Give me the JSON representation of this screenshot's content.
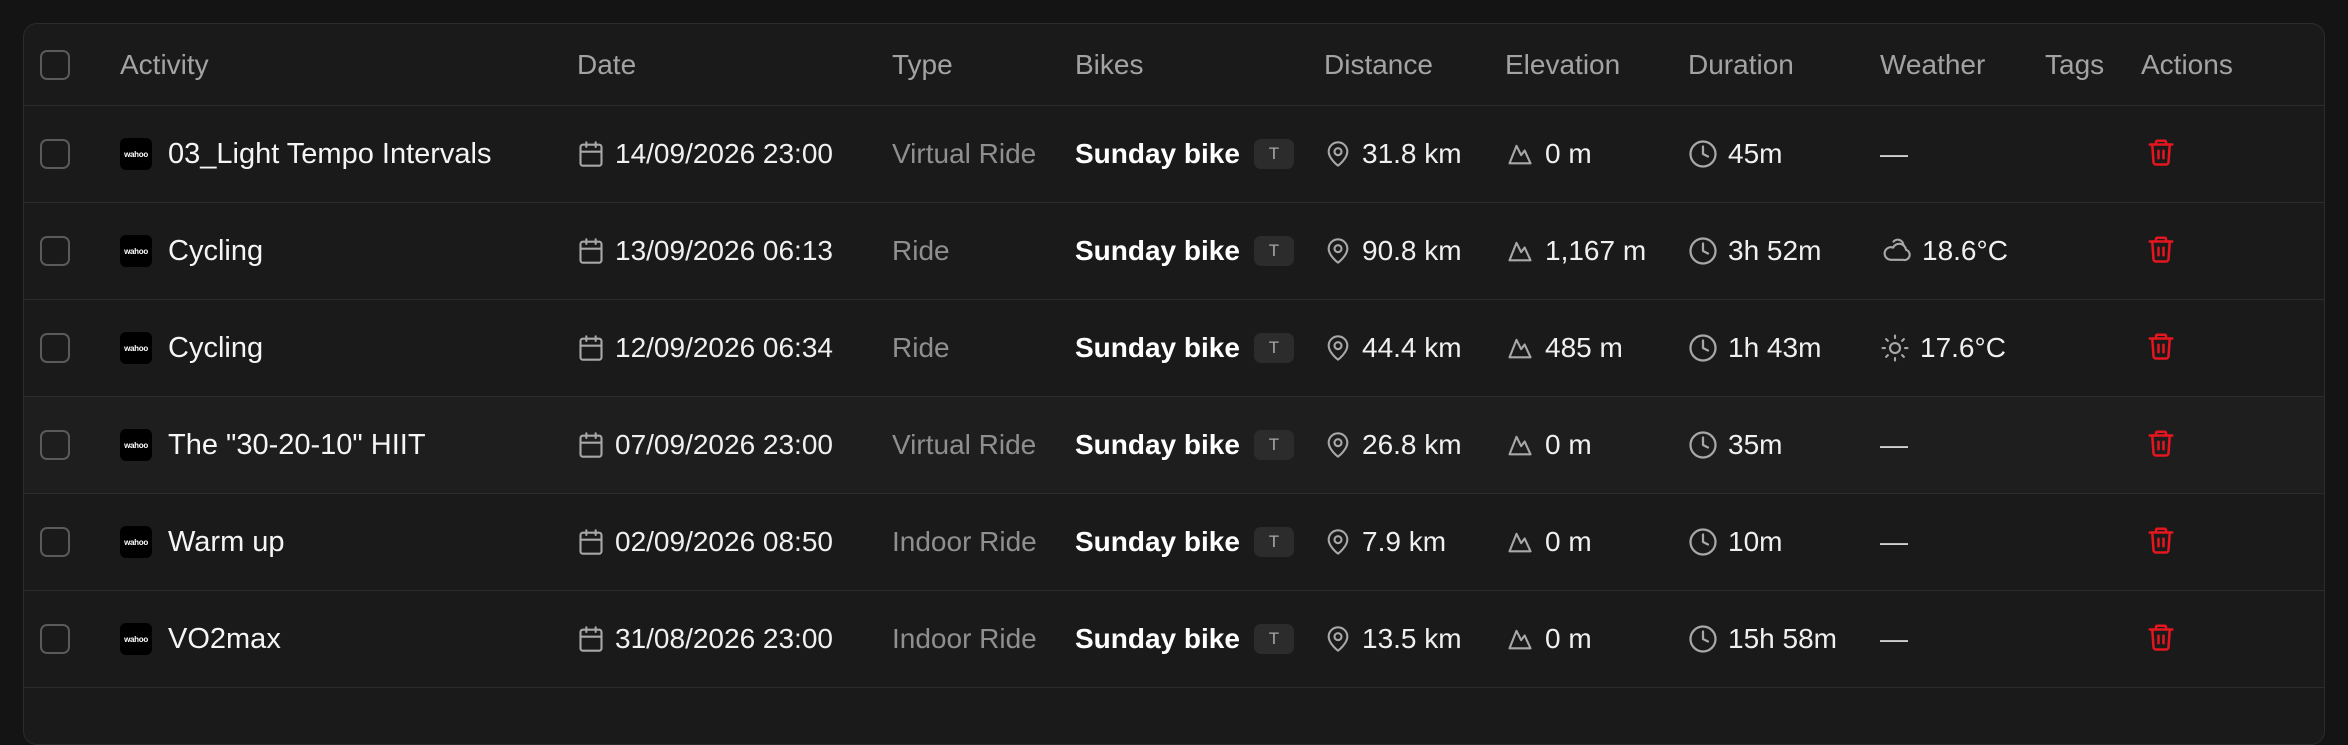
{
  "table": {
    "headers": {
      "activity": "Activity",
      "date": "Date",
      "type": "Type",
      "bikes": "Bikes",
      "distance": "Distance",
      "elevation": "Elevation",
      "duration": "Duration",
      "weather": "Weather",
      "tags": "Tags",
      "actions": "Actions"
    },
    "rows": [
      {
        "source": "wahoo",
        "name": "03_Light Tempo Intervals",
        "date": "14/09/2026 23:00",
        "type": "Virtual Ride",
        "bike": "Sunday bike",
        "bike_badge": "T",
        "distance": "31.8 km",
        "elevation": "0 m",
        "duration": "45m",
        "weather_icon": "none",
        "weather": "—"
      },
      {
        "source": "wahoo",
        "name": "Cycling",
        "date": "13/09/2026 06:13",
        "type": "Ride",
        "bike": "Sunday bike",
        "bike_badge": "T",
        "distance": "90.8 km",
        "elevation": "1,167 m",
        "duration": "3h 52m",
        "weather_icon": "cloud-sun-icon",
        "weather": "18.6°C"
      },
      {
        "source": "wahoo",
        "name": "Cycling",
        "date": "12/09/2026 06:34",
        "type": "Ride",
        "bike": "Sunday bike",
        "bike_badge": "T",
        "distance": "44.4 km",
        "elevation": "485 m",
        "duration": "1h 43m",
        "weather_icon": "sun-icon",
        "weather": "17.6°C"
      },
      {
        "source": "wahoo",
        "name": "The \"30-20-10\" HIIT",
        "date": "07/09/2026 23:00",
        "type": "Virtual Ride",
        "bike": "Sunday bike",
        "bike_badge": "T",
        "distance": "26.8 km",
        "elevation": "0 m",
        "duration": "35m",
        "weather_icon": "none",
        "weather": "—"
      },
      {
        "source": "wahoo",
        "name": "Warm up",
        "date": "02/09/2026 08:50",
        "type": "Indoor Ride",
        "bike": "Sunday bike",
        "bike_badge": "T",
        "distance": "7.9 km",
        "elevation": "0 m",
        "duration": "10m",
        "weather_icon": "none",
        "weather": "—"
      },
      {
        "source": "wahoo",
        "name": "VO2max",
        "date": "31/08/2026 23:00",
        "type": "Indoor Ride",
        "bike": "Sunday bike",
        "bike_badge": "T",
        "distance": "13.5 km",
        "elevation": "0 m",
        "duration": "15h 58m",
        "weather_icon": "none",
        "weather": "—"
      }
    ]
  },
  "colors": {
    "background": "#141414",
    "surface": "#1a1a1a",
    "delete": "#e5161f",
    "muted_text": "#8f8f8f"
  }
}
